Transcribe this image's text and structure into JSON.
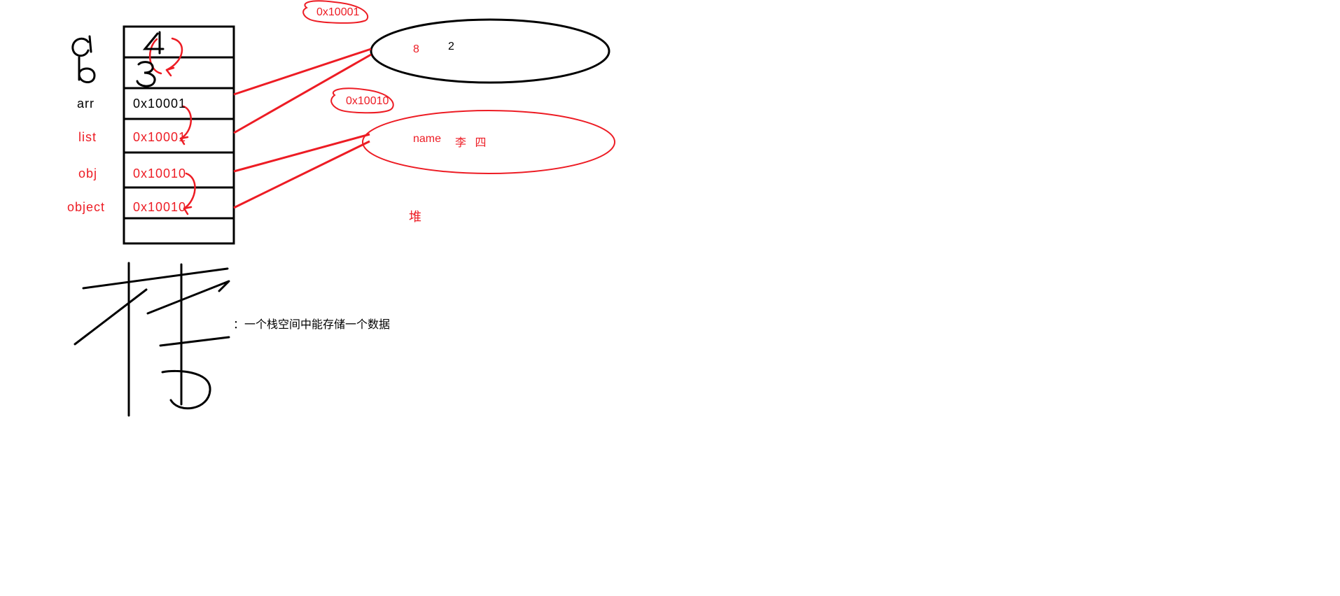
{
  "stack": {
    "labels": {
      "a": "a",
      "b": "b",
      "arr": "arr",
      "list": "list",
      "obj": "obj",
      "object": "object"
    },
    "cells": {
      "r0": "4",
      "r1": "3",
      "r2": "0x10001",
      "r3": "0x10001",
      "r4": "0x10010",
      "r5": "0x10010"
    }
  },
  "heap": {
    "label": "堆",
    "addr1": "0x10001",
    "addr2": "0x10010",
    "ellipse1": {
      "v1": "8",
      "v2": "2"
    },
    "ellipse2": {
      "nameKey": "name",
      "nameVal": "李 四"
    }
  },
  "footer": {
    "note": "：一个栈空间中能存储一个数据"
  }
}
